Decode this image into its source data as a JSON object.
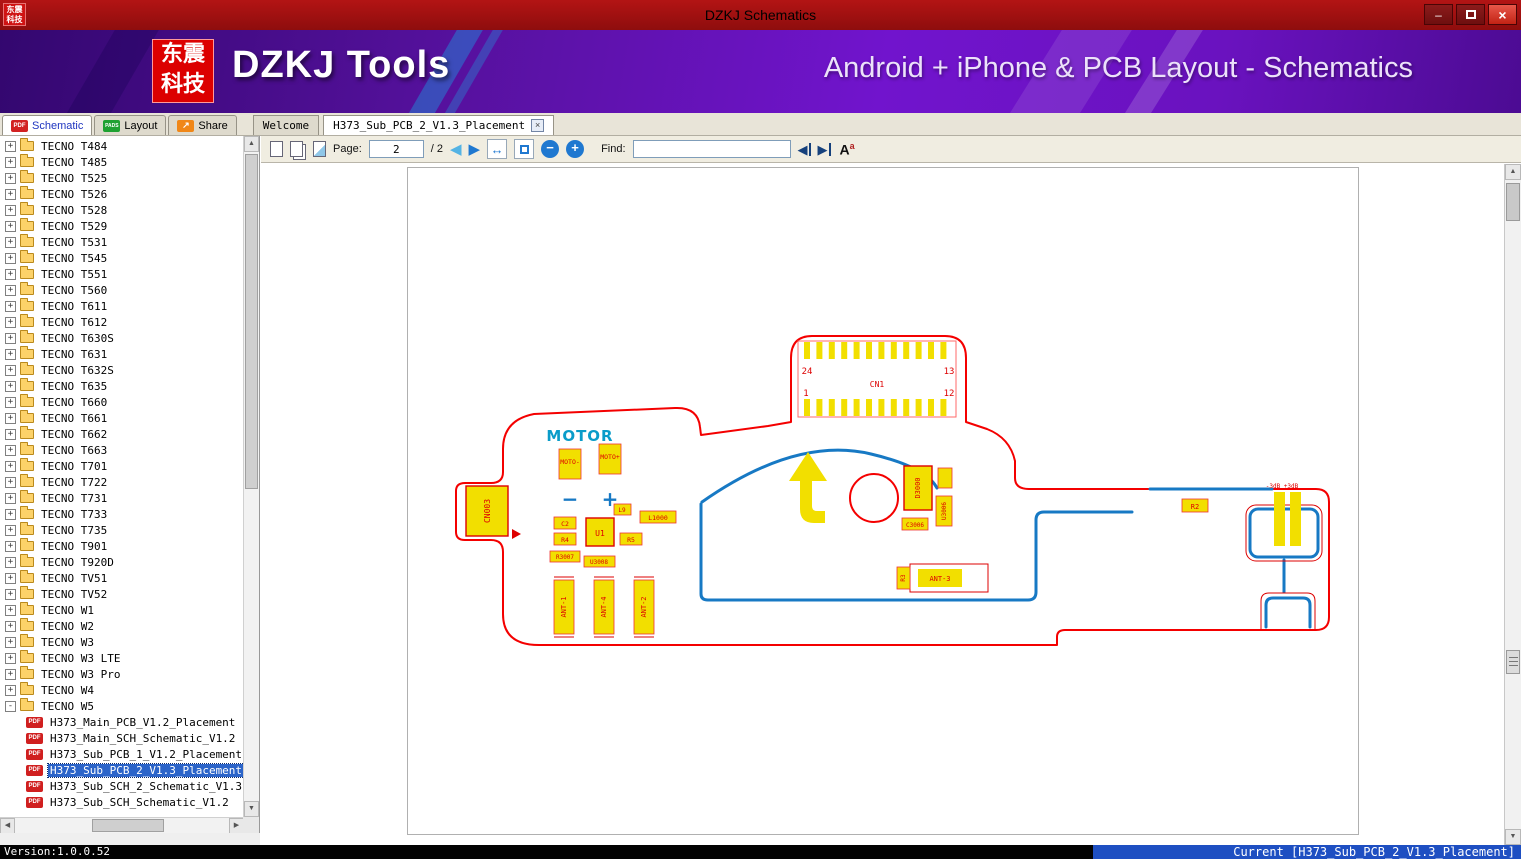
{
  "window": {
    "title": "DZKJ Schematics",
    "icon_text": "东震科技",
    "controls": {
      "minimize": "–",
      "close": "×"
    }
  },
  "banner": {
    "logo_line1": "东震",
    "logo_line2": "科技",
    "brand": "DZKJ Tools",
    "subtitle": "Android + iPhone & PCB Layout - Schematics"
  },
  "tabs": {
    "app_tabs": [
      {
        "label": "Schematic",
        "icon": "PDF"
      },
      {
        "label": "Layout",
        "icon": "PADS"
      },
      {
        "label": "Share",
        "icon": "↗"
      }
    ],
    "doc_tabs": [
      {
        "label": "Welcome"
      },
      {
        "label": "H373_Sub_PCB_2_V1.3_Placement",
        "close": "×"
      }
    ]
  },
  "toolbar": {
    "page_label": "Page:",
    "page_value": "2",
    "page_suffix": "/ 2",
    "prev_icon": "◀",
    "next_icon": "▶",
    "fit_width_icon": "↔",
    "zoom_out": "−",
    "zoom_in": "+",
    "find_label": "Find:",
    "find_value": "",
    "find_prev_icon": "◀",
    "find_next_icon": "▶",
    "text_size_icon": "A",
    "text_size_sup": "a"
  },
  "sidebar": {
    "pdf_icon": "PDF",
    "folders": [
      {
        "label": "TECNO T484"
      },
      {
        "label": "TECNO T485"
      },
      {
        "label": "TECNO T525"
      },
      {
        "label": "TECNO T526"
      },
      {
        "label": "TECNO T528"
      },
      {
        "label": "TECNO T529"
      },
      {
        "label": "TECNO T531"
      },
      {
        "label": "TECNO T545"
      },
      {
        "label": "TECNO T551"
      },
      {
        "label": "TECNO T560"
      },
      {
        "label": "TECNO T611"
      },
      {
        "label": "TECNO T612"
      },
      {
        "label": "TECNO T630S"
      },
      {
        "label": "TECNO T631"
      },
      {
        "label": "TECNO T632S"
      },
      {
        "label": "TECNO T635"
      },
      {
        "label": "TECNO T660"
      },
      {
        "label": "TECNO T661"
      },
      {
        "label": "TECNO T662"
      },
      {
        "label": "TECNO T663"
      },
      {
        "label": "TECNO T701"
      },
      {
        "label": "TECNO T722"
      },
      {
        "label": "TECNO T731"
      },
      {
        "label": "TECNO T733"
      },
      {
        "label": "TECNO T735"
      },
      {
        "label": "TECNO T901"
      },
      {
        "label": "TECNO T920D"
      },
      {
        "label": "TECNO TV51"
      },
      {
        "label": "TECNO TV52"
      },
      {
        "label": "TECNO W1"
      },
      {
        "label": "TECNO W2"
      },
      {
        "label": "TECNO W3"
      },
      {
        "label": "TECNO W3 LTE"
      },
      {
        "label": "TECNO W3 Pro"
      },
      {
        "label": "TECNO W4"
      },
      {
        "label": "TECNO W5",
        "expanded": true
      }
    ],
    "documents": [
      {
        "label": "H373_Main_PCB_V1.2_Placement"
      },
      {
        "label": "H373_Main_SCH_Schematic_V1.2"
      },
      {
        "label": "H373_Sub_PCB_1_V1.2_Placement"
      },
      {
        "label": "H373_Sub_PCB_2_V1.3_Placement",
        "selected": true
      },
      {
        "label": "H373_Sub_SCH_2_Schematic_V1.3"
      },
      {
        "label": "H373_Sub_SCH_Schematic_V1.2"
      }
    ]
  },
  "drawing": {
    "labels": {
      "motor": "MOTOR",
      "moto_minus": "MOTO-",
      "moto_plus": "MOTO+",
      "minus_sign": "−",
      "plus_sign": "+",
      "cn1": "CN1",
      "pin24": "24",
      "pin13": "13",
      "pin1": "1",
      "pin12": "12",
      "cn003": "CN003",
      "c2": "C2",
      "r4": "R4",
      "u1": "U1",
      "r5": "R5",
      "l9": "L9",
      "l1000": "L1000",
      "r3007": "R3007",
      "u3008": "U3008",
      "ant1": "ANT-1",
      "ant4": "ANT-4",
      "ant2": "ANT-2",
      "ant3": "ANT-3",
      "r3": "R3",
      "d3000": "D3000",
      "c3006": "C3006",
      "u3006": "U3006",
      "r2": "R2",
      "db_marking": "-3dB +3dB"
    }
  },
  "statusbar": {
    "left": "Version:1.0.0.52",
    "right": "Current [H373_Sub_PCB_2_V1.3_Placement]"
  },
  "colors": {
    "board_outline": "#f40000",
    "trace_blue": "#1779c4",
    "component_yellow": "#f2df00",
    "banner_purple": "#6f15c9",
    "titlebar_red": "#a31111",
    "status_blue": "#1e4fc2"
  }
}
